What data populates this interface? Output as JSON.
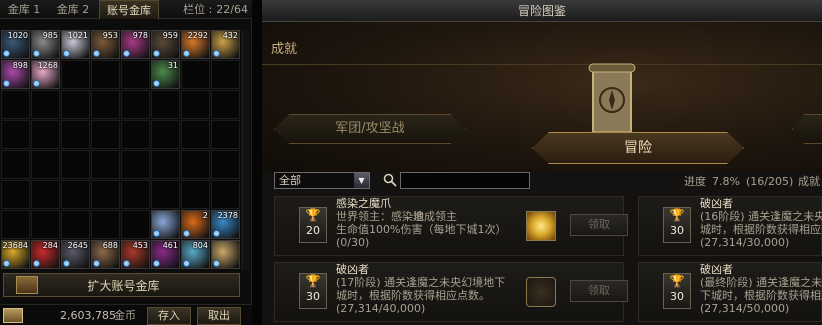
{
  "storage": {
    "tabs": [
      "金库 1",
      "金库 2",
      "账号金库"
    ],
    "slots_label": "栏位 :",
    "slots_value": "22/64",
    "items": [
      {
        "count": "1020",
        "color": "#3a5a7a"
      },
      {
        "count": "985",
        "color": "#8a8a8a"
      },
      {
        "count": "1021",
        "color": "#c8c8d8"
      },
      {
        "count": "953",
        "color": "#7a5a3a"
      },
      {
        "count": "978",
        "color": "#aa3a8a"
      },
      {
        "count": "959",
        "color": "#5a4a3a"
      },
      {
        "count": "2292",
        "color": "#d87a2a"
      },
      {
        "count": "432",
        "color": "#caa04a"
      },
      {
        "count": "898",
        "color": "#aa4aaa"
      },
      {
        "count": "1268",
        "color": "#e8a8c8"
      },
      {
        "count": "31",
        "color": "#4a8a4a"
      },
      {
        "count": "",
        "color": "#8aa8d8"
      },
      {
        "count": "2",
        "color": "#d86a1a"
      },
      {
        "count": "2378",
        "color": "#3a8aca"
      },
      {
        "count": "23684",
        "color": "#d8a82a"
      },
      {
        "count": "284",
        "color": "#ca2a2a"
      },
      {
        "count": "2645",
        "color": "#5a5a6a"
      },
      {
        "count": "688",
        "color": "#8a6a4a"
      },
      {
        "count": "453",
        "color": "#aa3a2a"
      },
      {
        "count": "461",
        "color": "#8a2a8a"
      },
      {
        "count": "804",
        "color": "#5aaaca"
      },
      {
        "count": "",
        "color": "#caa86a"
      }
    ],
    "expand_label": "扩大账号金库",
    "gold_amount": "2,603,785",
    "gold_unit": "金币",
    "deposit_label": "存入",
    "withdraw_label": "取出"
  },
  "codex": {
    "title": "冒险图鉴",
    "section": "成就",
    "tab_left": "军团/攻坚战",
    "tab_main": "冒险",
    "filter_value": "全部",
    "search_value": "",
    "progress_label": "进度",
    "progress_pct": "7.8%",
    "progress_count": "(16/205)",
    "progress_extra": "成就",
    "cards": [
      {
        "points": "20",
        "name": "感染之魔爪",
        "desc_line1a": "世界领主：感染地",
        "desc_line1b": "造成领主",
        "desc_line2": "生命值100%伤害（每地下城1次）",
        "progress": "(0/30)",
        "claim": "领取",
        "reward_color": "#d8a82a"
      },
      {
        "points": "30",
        "name": "破凶者",
        "desc_line1": "(17阶段) 通关逢魔之未央幻境地下",
        "desc_line2": "城时，根据阶数获得相应点数。",
        "progress": "(27,314/40,000)",
        "claim": "领取",
        "reward_color": "#caa86a"
      },
      {
        "points": "30",
        "name": "破凶者",
        "desc_line1": "(16阶段) 通关逢魔之未央幻",
        "desc_line2": "城时，根据阶数获得相应点",
        "progress": "(27,314/30,000)"
      },
      {
        "points": "30",
        "name": "破凶者",
        "desc_line1": "(最终阶段) 通关逢魔之未央",
        "desc_line2": "下城时，根据阶数获得相应",
        "progress": "(27,314/50,000)"
      }
    ]
  }
}
